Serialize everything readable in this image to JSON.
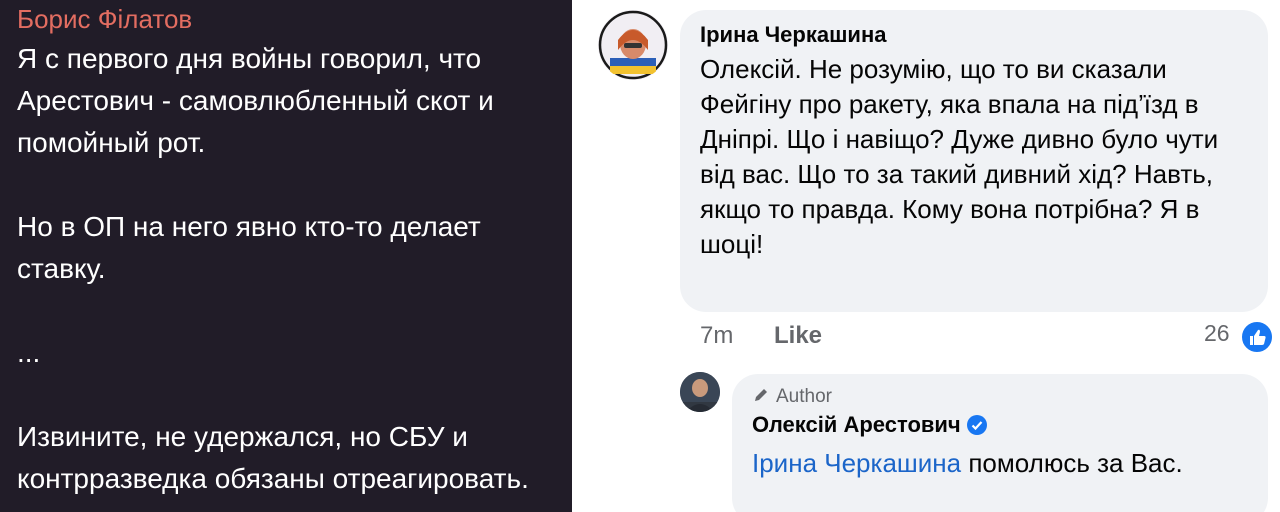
{
  "telegram": {
    "sender": "Борис Філатов",
    "paragraphs": [
      "Я с первого дня войны говорил, что Арестович - самовлюбленный скот и помойный рот.",
      "Но в ОП на него явно кто-то делает ставку.",
      "...",
      "Извините, не удержался, но СБУ и контрразведка обязаны отреагировать."
    ]
  },
  "facebook": {
    "comment": {
      "author": "Ірина Черкашина",
      "text": "Олексій. Не розумію, що то ви сказали Фейгіну про ракету, яка впала на під’їзд в Дніпрі. Що і навіщо? Дуже дивно було чути від вас. Що то за такий дивний хід? Навть, якщо то правда. Кому вона потрібна? Я в шоці!",
      "time": "7m",
      "like_label": "Like",
      "reaction_count": "26"
    },
    "reply": {
      "badge": "Author",
      "author": "Олексій Арестович",
      "mention": "Ірина Черкашина",
      "text": "помолюсь за Вас."
    }
  }
}
